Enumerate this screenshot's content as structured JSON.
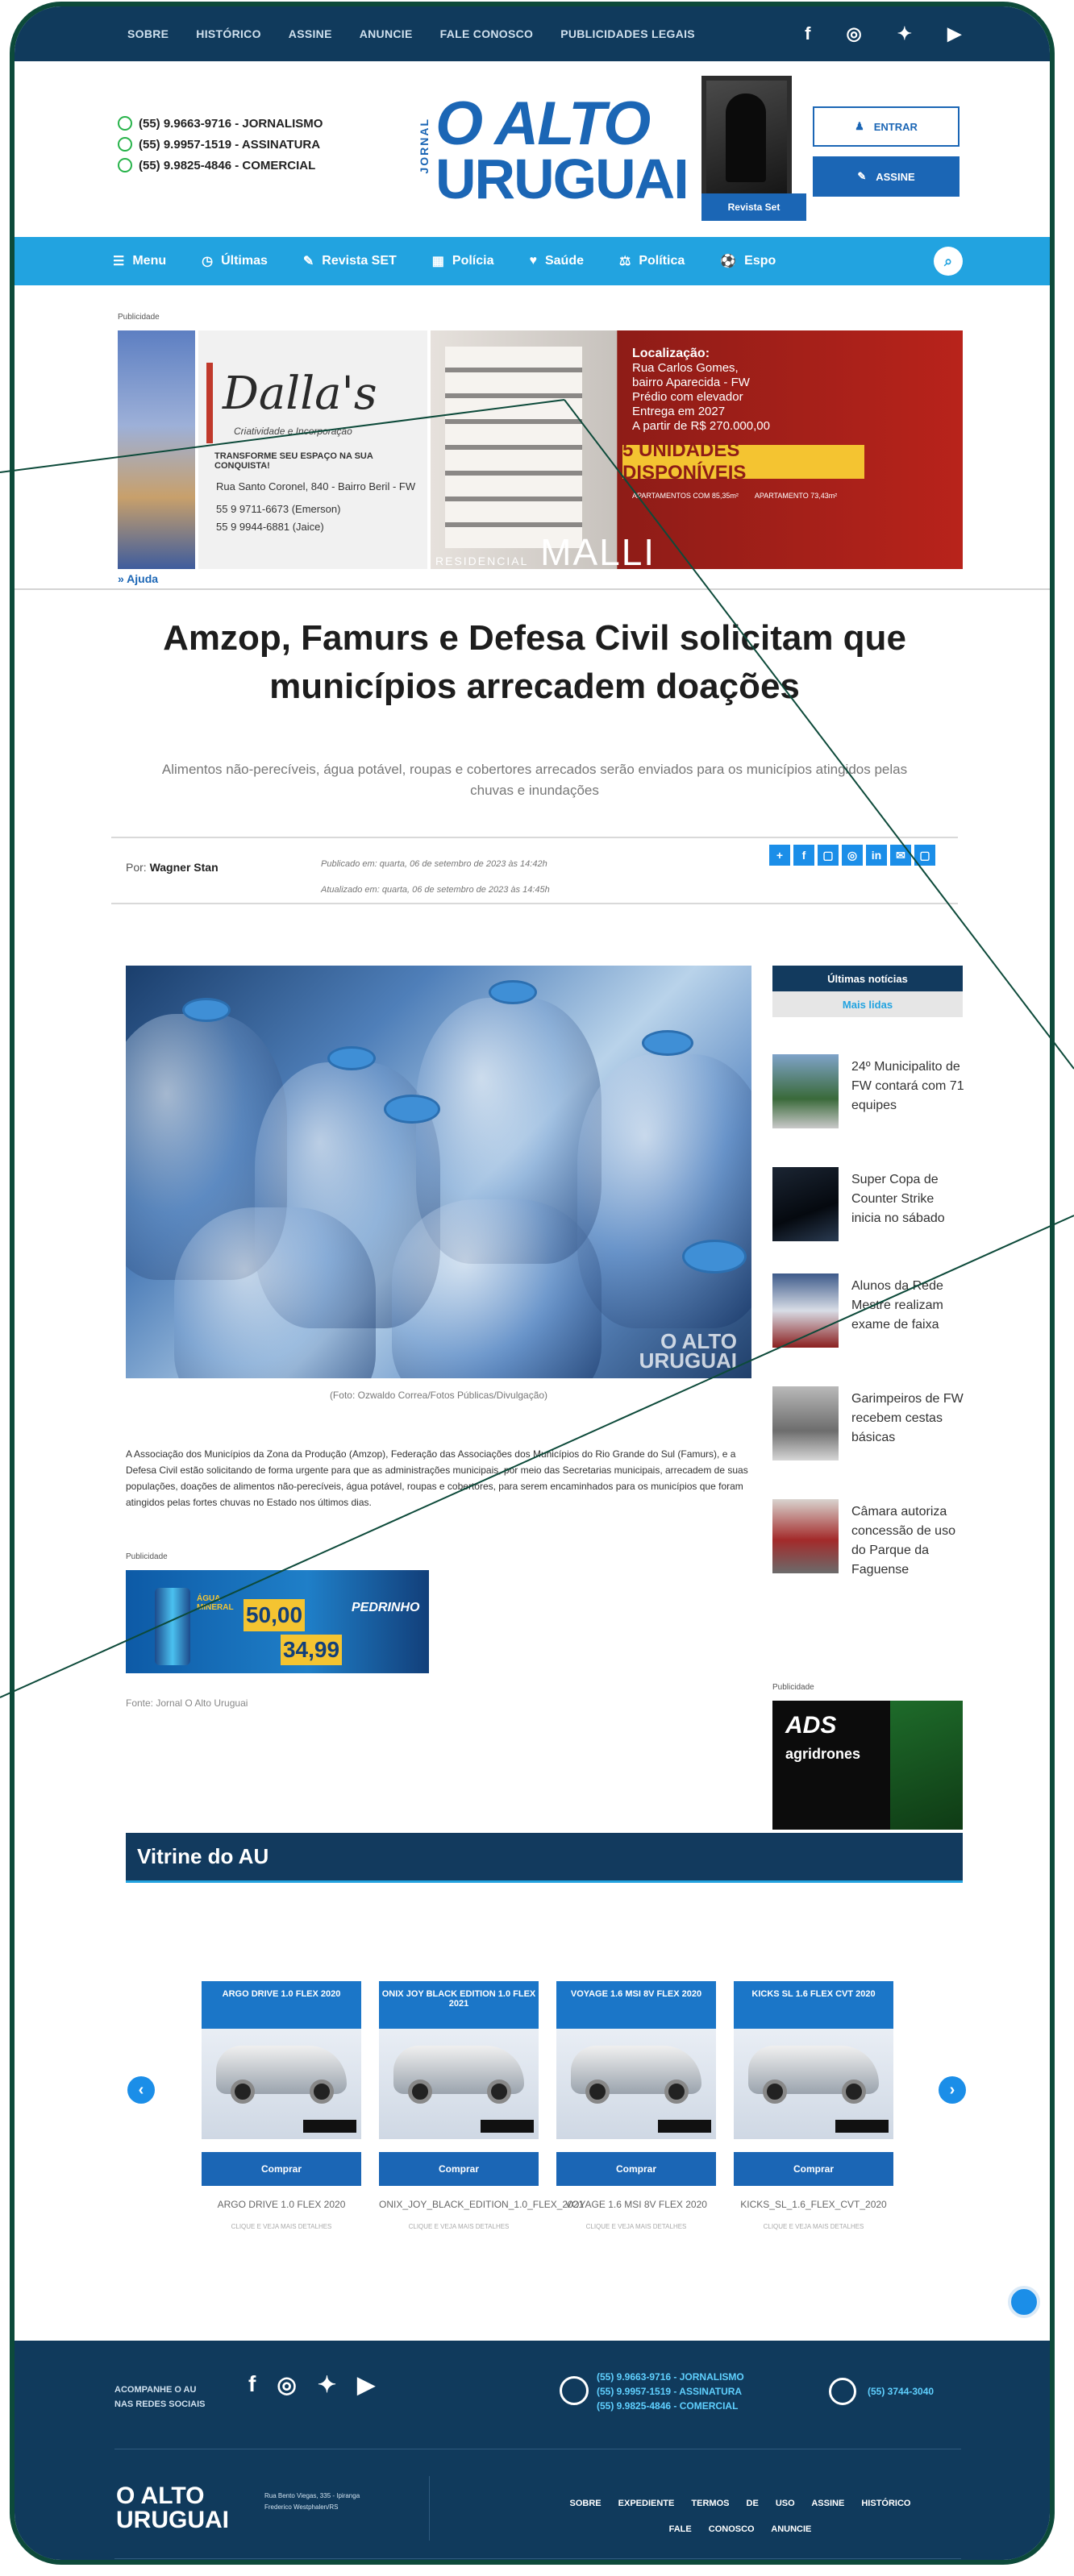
{
  "topbar": {
    "links": [
      "SOBRE",
      "HISTÓRICO",
      "ASSINE",
      "ANUNCIE",
      "FALE CONOSCO",
      "PUBLICIDADES LEGAIS"
    ],
    "social_icons": [
      "facebook-icon",
      "instagram-icon",
      "twitter-icon",
      "youtube-icon"
    ]
  },
  "header": {
    "phones": [
      "(55) 9.9663-9716 - JORNALISMO",
      "(55) 9.9957-1519 - ASSINATURA",
      "(55) 9.9825-4846 - COMERCIAL"
    ],
    "logo_vertical": "JORNAL",
    "logo_line1": "O ALTO",
    "logo_line2": "URUGUAI",
    "magazine_button": "Revista Set",
    "entrar": "ENTRAR",
    "assine": "ASSINE"
  },
  "nav": {
    "items": [
      {
        "icon": "☰",
        "label": "Menu"
      },
      {
        "icon": "◷",
        "label": "Últimas"
      },
      {
        "icon": "✎",
        "label": "Revista SET"
      },
      {
        "icon": "▦",
        "label": "Polícia"
      },
      {
        "icon": "♥",
        "label": "Saúde"
      },
      {
        "icon": "⚖",
        "label": "Política"
      },
      {
        "icon": "⚽",
        "label": "Espo"
      }
    ]
  },
  "top_ad": {
    "label": "Publicidade",
    "brand": "Dalla's",
    "brand_sub": "Criatividade e Incorporação",
    "brand_tag": "TRANSFORME SEU ESPAÇO NA SUA CONQUISTA!",
    "brand_addr": "Rua Santo Coronel, 840 - Bairro Beril - FW",
    "brand_phone1": "55 9 9711-6673 (Emerson)",
    "brand_phone2": "55 9 9944-6881 (Jaice)",
    "location_title": "Localização:",
    "location_lines": [
      "Rua Carlos Gomes,",
      "bairro Aparecida - FW",
      "Prédio com elevador",
      "Entrega em 2027",
      "A partir de R$ 270.000,00"
    ],
    "units": "5 UNIDADES DISPONÍVEIS",
    "residencial": "RESIDENCIAL",
    "malli": "MALLI",
    "apt1": "APARTAMENTOS COM 85,35m²",
    "apt2": "APARTAMENTO 73,43m²",
    "help": "Ajuda"
  },
  "article": {
    "title": "Amzop, Famurs e Defesa Civil solicitam que municípios arrecadem doações",
    "subtitle": "Alimentos não-perecíveis, água potável, roupas e cobertores arrecados serão enviados para os municípios atingidos pelas chuvas e inundações",
    "by_label": "Por",
    "author": "Wagner Stan",
    "published": "Publicado em: quarta, 06 de setembro de 2023 às 14:42h",
    "updated": "Atualizado em: quarta, 06 de setembro de 2023 às 14:45h",
    "share_icons": [
      "+",
      "f",
      "▢",
      "◎",
      "in",
      "✉",
      "▢"
    ],
    "image_watermark_1": "O ALTO",
    "image_watermark_2": "URUGUAI",
    "caption": "(Foto: Ozwaldo Correa/Fotos Públicas/Divulgação)",
    "body": "A Associação dos Municípios da Zona da Produção (Amzop), Federação das Associações dos Municípios do Rio Grande do Sul (Famurs), e a Defesa Civil estão solicitando de forma urgente para que as administrações municipais, por meio das Secretarias municipais, arrecadem de suas populações, doações de alimentos não-perecíveis, água potável, roupas e cobertores, para serem encaminhados para os municípios que foram atingidos pelas fortes chuvas no Estado nos últimos dias.",
    "mid_ad_label": "Publicidade",
    "mid_ad_price1": "50,00",
    "mid_ad_price2": "34,99",
    "mid_ad_brand": "PEDRINHO",
    "mid_ad_small": "ÁGUA MINERAL",
    "source": "Fonte: Jornal O Alto Uruguai"
  },
  "sidebar": {
    "tab1": "Últimas notícias",
    "tab2": "Mais lidas",
    "news": [
      "24º Municipalito de FW contará com 71 equipes",
      "Super Copa de Counter Strike inicia no sábado",
      "Alunos da Rede Mestre realizam exame de faixa",
      "Garimpeiros de FW recebem cestas básicas",
      "Câmara autoriza concessão de uso do Parque da Faguense"
    ],
    "ad_label": "Publicidade",
    "ad_brand": "ADS",
    "ad_sub": "agridrones"
  },
  "vitrine": {
    "title": "Vitrine do AU",
    "cards": [
      {
        "banner": "ARGO DRIVE 1.0 FLEX 2020",
        "buy": "Comprar",
        "name": "ARGO DRIVE 1.0 FLEX 2020",
        "hint": "CLIQUE E VEJA MAIS DETALHES"
      },
      {
        "banner": "ONIX JOY BLACK EDITION 1.0 FLEX 2021",
        "buy": "Comprar",
        "name": "ONIX_JOY_BLACK_EDITION_1.0_FLEX_2021",
        "hint": "CLIQUE E VEJA MAIS DETALHES"
      },
      {
        "banner": "VOYAGE 1.6 MSI 8V FLEX 2020",
        "buy": "Comprar",
        "name": "VOYAGE 1.6 MSI 8V FLEX 2020",
        "hint": "CLIQUE E VEJA MAIS DETALHES"
      },
      {
        "banner": "KICKS SL 1.6 FLEX CVT 2020",
        "buy": "Comprar",
        "name": "KICKS_SL_1.6_FLEX_CVT_2020",
        "hint": "CLIQUE E VEJA MAIS DETALHES"
      }
    ]
  },
  "footer": {
    "follow_line1": "ACOMPANHE O AU",
    "follow_line2": "NAS REDES SOCIAIS",
    "phones": [
      "(55) 9.9663-9716 - JORNALISMO",
      "(55) 9.9957-1519 - ASSINATURA",
      "(55) 9.9825-4846 - COMERCIAL"
    ],
    "call": "(55) 3744-3040",
    "logo_line1": "O ALTO",
    "logo_line2": "URUGUAI",
    "address": "Rua Bento Viegas, 335 - Ipiranga\nFrederico Westphalen/RS",
    "links_row1": "SOBRE EXPEDIENTE TERMOS DE USO ASSINE HISTÓRICO",
    "links_row2": "FALE CONOSCO ANUNCIE"
  },
  "colors": {
    "primary_dark": "#103a5c",
    "nav_blue": "#22a3e0",
    "brand_blue": "#1b66b5",
    "frame_green": "#0d4a3a"
  }
}
